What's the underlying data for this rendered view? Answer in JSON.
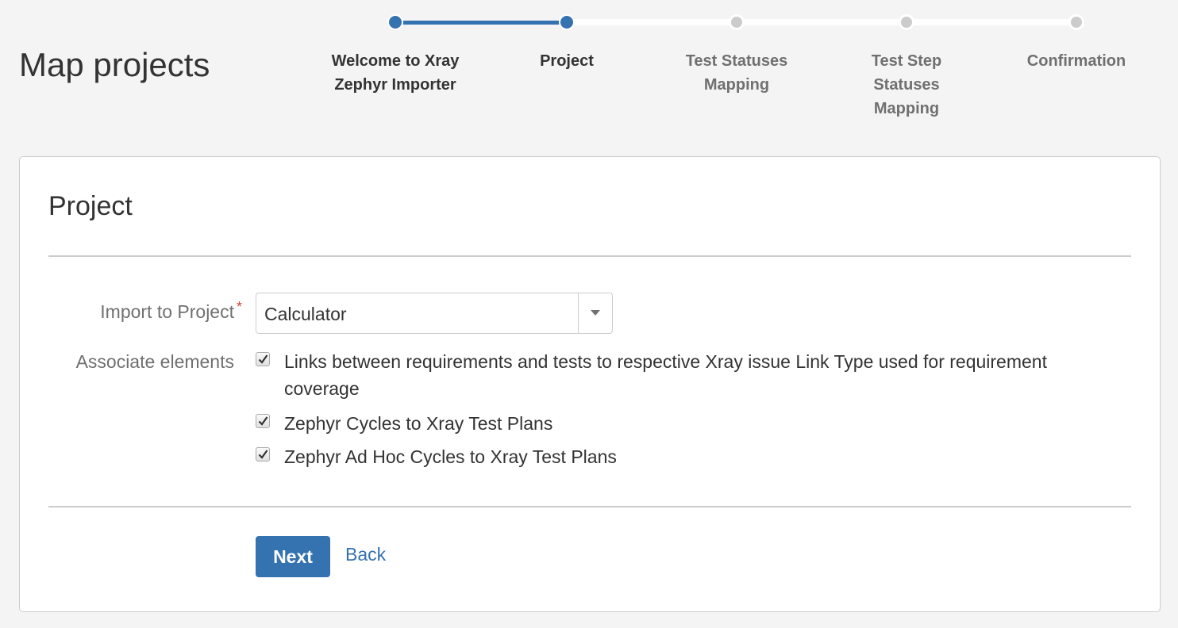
{
  "page": {
    "title": "Map projects"
  },
  "progress": {
    "steps": [
      {
        "label": "Welcome to Xray Zephyr Importer",
        "state": "completed"
      },
      {
        "label": "Project",
        "state": "current"
      },
      {
        "label": "Test Statuses Mapping",
        "state": "pending"
      },
      {
        "label": "Test Step Statuses Mapping",
        "state": "pending"
      },
      {
        "label": "Confirmation",
        "state": "pending"
      }
    ]
  },
  "panel": {
    "title": "Project",
    "import_label": "Import to Project",
    "required_marker": "*",
    "project_select": {
      "value": "Calculator"
    },
    "associate_label": "Associate elements",
    "options": [
      {
        "label": "Links between requirements and tests to respective Xray issue Link Type used for requirement coverage",
        "checked": true
      },
      {
        "label": "Zephyr Cycles to Xray Test Plans",
        "checked": true
      },
      {
        "label": "Zephyr Ad Hoc Cycles to Xray Test Plans",
        "checked": true
      }
    ],
    "next_label": "Next",
    "back_label": "Back"
  },
  "colors": {
    "accent": "#3572b0",
    "required": "#d04437",
    "pending_step": "#cccccc"
  }
}
